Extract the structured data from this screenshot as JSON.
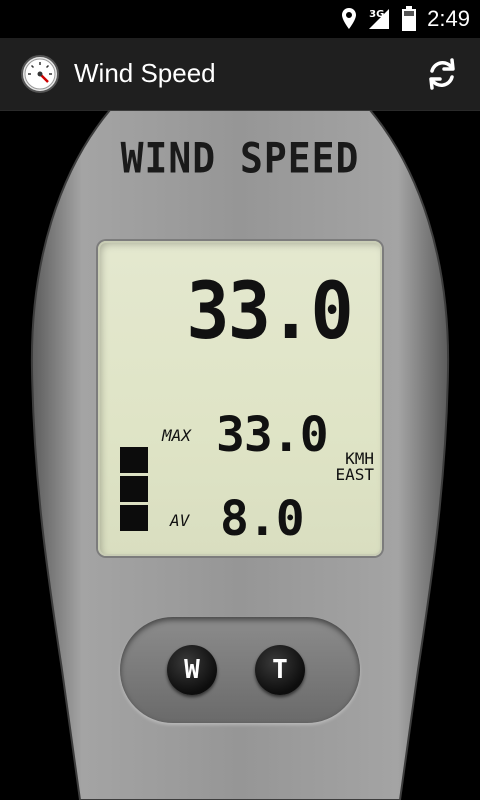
{
  "statusbar": {
    "time": "2:49",
    "network": "3G"
  },
  "appbar": {
    "title": "Wind Speed",
    "icons": {
      "app": "gauge-icon",
      "refresh": "refresh-icon"
    }
  },
  "device": {
    "header": "WIND SPEED",
    "display": {
      "current": "33.0",
      "max_label": "MAX",
      "max_value": "33.0",
      "avg_label": "AV",
      "avg_value": "8.0",
      "unit": "KMH",
      "direction": "EAST",
      "level_bars": 3
    },
    "buttons": {
      "w": "W",
      "t": "T"
    }
  },
  "colors": {
    "lcd_background": "#dfe4c6",
    "device_body": "#8e8e8e",
    "actionbar": "#1f1f1f"
  }
}
